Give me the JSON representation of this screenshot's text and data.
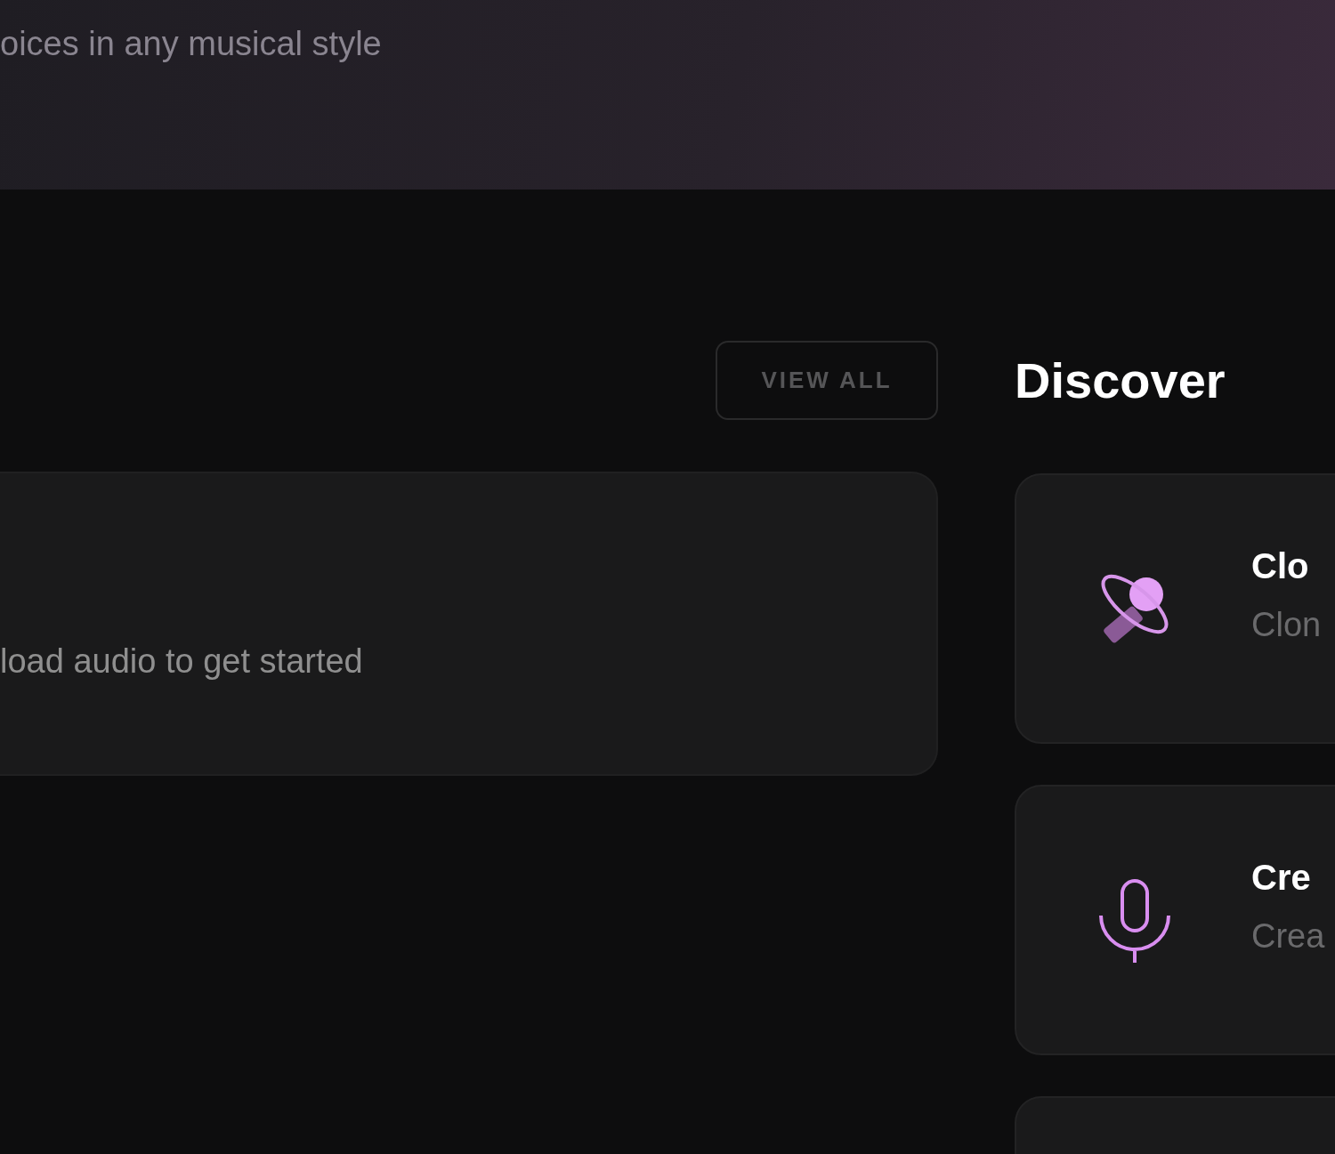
{
  "header": {
    "subtitle": "oices in any musical style"
  },
  "recent": {
    "view_all": "VIEW ALL",
    "empty_message": "load audio to get started"
  },
  "discover": {
    "title": "Discover",
    "cards": [
      {
        "kind": "clone",
        "title": "Clo",
        "subtitle": "Clon"
      },
      {
        "kind": "create",
        "title": "Cre",
        "subtitle": "Crea"
      },
      {
        "kind": "empty"
      }
    ]
  }
}
